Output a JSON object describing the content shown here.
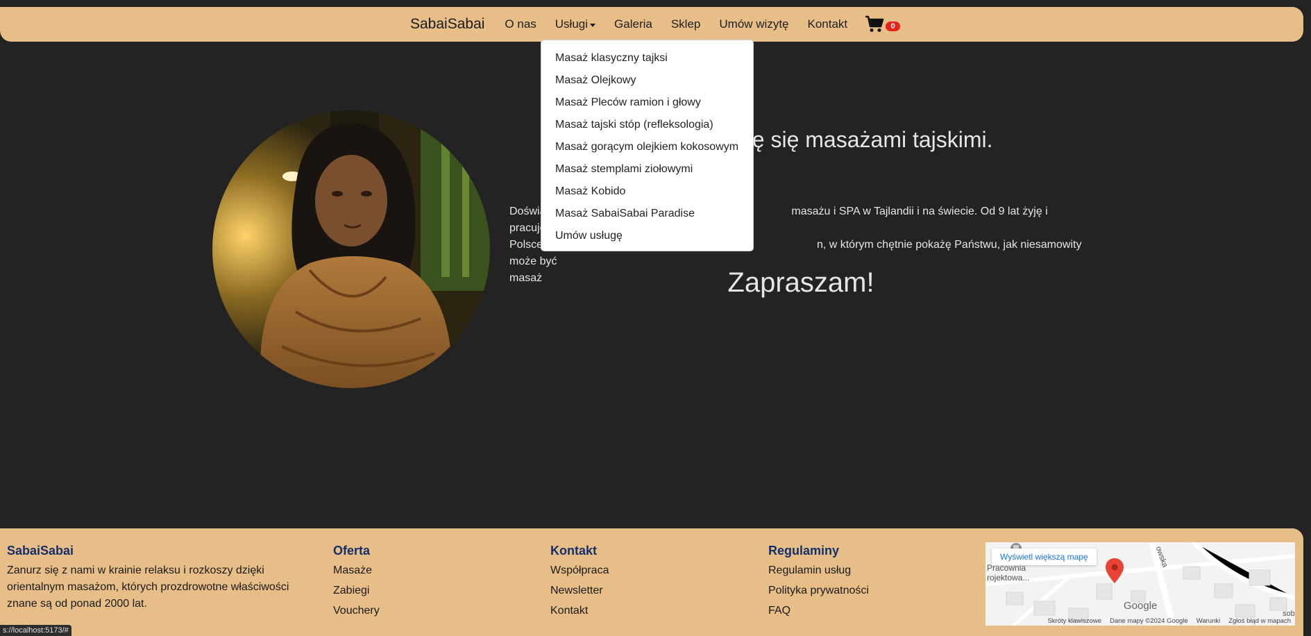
{
  "nav": {
    "brand": "SabaiSabai",
    "links": [
      "O nas",
      "Usługi",
      "Galeria",
      "Sklep",
      "Umów wizytę",
      "Kontakt"
    ],
    "cart_count": "0"
  },
  "dropdown": {
    "items": [
      "Masaż klasyczny tajksi",
      "Masaż Olejkowy",
      "Masaż Pleców ramion i głowy",
      "Masaż tajski stóp (refleksologia)",
      "Masaż gorącym olejkiem kokosowym",
      "Masaż stemplami ziołowymi",
      "Masaż Kobido",
      "Masaż SabaiSabai Paradise",
      "Umów usługę"
    ]
  },
  "hero": {
    "title_visible": "d 20 lat zajmuję się masażami tajskimi.",
    "line1_left": "Doświa",
    "line1_right": "masażu i SPA w Tajlandii i na świecie. Od 9 lat żyję i pracuję w",
    "line2_left": "Polsce",
    "line2_right": "n, w którym chętnie pokażę Państwu, jak niesamowity może być",
    "line3_left": "masaż",
    "invite": "Zapraszam!"
  },
  "footer": {
    "about": {
      "title": "SabaiSabai",
      "text": "Zanurz się z nami w krainie relaksu i rozkoszy dzięki orientalnym masażom, których prozdrowotne właściwości znane są od ponad 2000 lat."
    },
    "oferta": {
      "title": "Oferta",
      "links": [
        "Masaże",
        "Zabiegi",
        "Vouchery"
      ]
    },
    "kontakt": {
      "title": "Kontakt",
      "links": [
        "Współpraca",
        "Newsletter",
        "Kontakt"
      ]
    },
    "regulaminy": {
      "title": "Regulaminy",
      "links": [
        "Regulamin usług",
        "Polityka prywatności",
        "FAQ"
      ]
    },
    "map": {
      "button": "Wyświetl większą mapę",
      "label_place": "Pracownia\nrojektowa...",
      "label_street": "owska",
      "label_corner": "sob",
      "google": "Google",
      "footer": [
        "Skróty klawiszowe",
        "Dane mapy ©2024 Google",
        "Warunki",
        "Zgłoś błąd w mapach"
      ]
    }
  },
  "status_url": "s://localhost:5173/#",
  "colors": {
    "navbar": "#e7be87",
    "background": "#232323",
    "footer_heading": "#14306b",
    "badge": "#e5231b"
  }
}
